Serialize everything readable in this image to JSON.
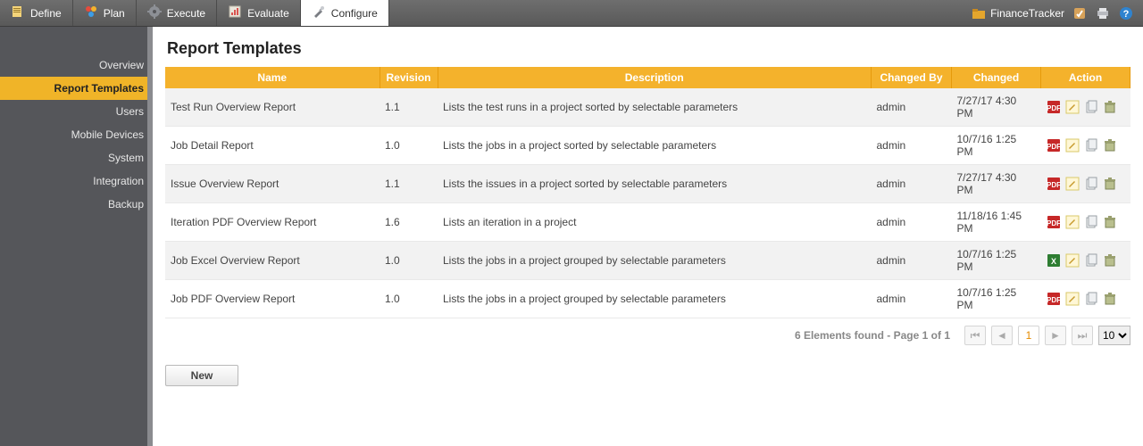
{
  "toolbar": {
    "tabs": [
      {
        "label": "Define",
        "icon": "define-icon"
      },
      {
        "label": "Plan",
        "icon": "plan-icon"
      },
      {
        "label": "Execute",
        "icon": "execute-icon"
      },
      {
        "label": "Evaluate",
        "icon": "evaluate-icon"
      },
      {
        "label": "Configure",
        "icon": "configure-icon"
      }
    ],
    "active_tab": 4,
    "project_name": "FinanceTracker"
  },
  "sidebar": {
    "items": [
      {
        "label": "Overview"
      },
      {
        "label": "Report Templates"
      },
      {
        "label": "Users"
      },
      {
        "label": "Mobile Devices"
      },
      {
        "label": "System"
      },
      {
        "label": "Integration"
      },
      {
        "label": "Backup"
      }
    ],
    "active_index": 1
  },
  "page": {
    "title": "Report Templates",
    "columns": [
      "Name",
      "Revision",
      "Description",
      "Changed By",
      "Changed",
      "Action"
    ],
    "rows": [
      {
        "name": "Test Run Overview Report",
        "revision": "1.1",
        "description": "Lists the test runs in a project sorted by selectable parameters",
        "changed_by": "admin",
        "changed": "7/27/17 4:30 PM",
        "file_kind": "pdf"
      },
      {
        "name": "Job Detail Report",
        "revision": "1.0",
        "description": "Lists the jobs in a project sorted by selectable parameters",
        "changed_by": "admin",
        "changed": "10/7/16 1:25 PM",
        "file_kind": "pdf"
      },
      {
        "name": "Issue Overview Report",
        "revision": "1.1",
        "description": "Lists the issues in a project sorted by selectable parameters",
        "changed_by": "admin",
        "changed": "7/27/17 4:30 PM",
        "file_kind": "pdf"
      },
      {
        "name": "Iteration PDF Overview Report",
        "revision": "1.6",
        "description": "Lists an iteration in a project",
        "changed_by": "admin",
        "changed": "11/18/16 1:45 PM",
        "file_kind": "pdf"
      },
      {
        "name": "Job Excel Overview Report",
        "revision": "1.0",
        "description": "Lists the jobs in a project grouped by selectable parameters",
        "changed_by": "admin",
        "changed": "10/7/16 1:25 PM",
        "file_kind": "excel"
      },
      {
        "name": "Job PDF Overview Report",
        "revision": "1.0",
        "description": "Lists the jobs in a project grouped by selectable parameters",
        "changed_by": "admin",
        "changed": "10/7/16 1:25 PM",
        "file_kind": "pdf"
      }
    ],
    "pagination": {
      "summary": "6 Elements found - Page 1 of 1",
      "current_page": "1",
      "page_size": "10"
    },
    "new_button": "New"
  },
  "colors": {
    "accent": "#f4b22c"
  }
}
